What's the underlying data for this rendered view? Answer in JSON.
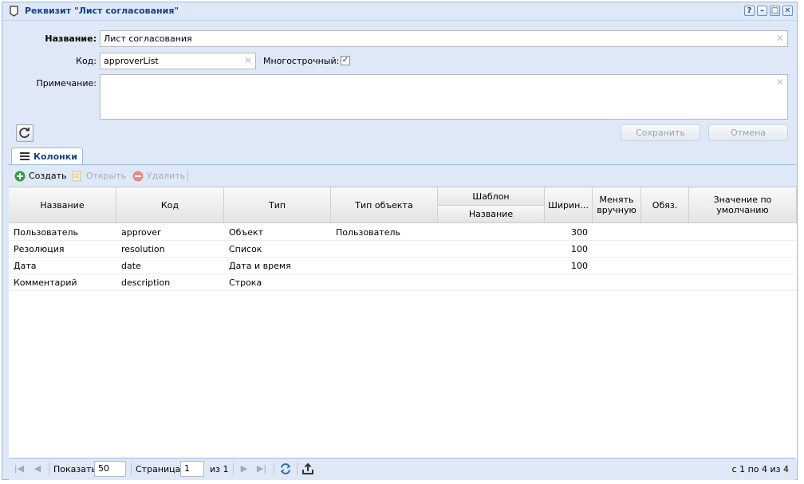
{
  "window": {
    "title": "Реквизит \"Лист согласования\"",
    "tools": [
      "?",
      "–",
      "□",
      "✕"
    ]
  },
  "form": {
    "name_label": "Название:",
    "name_value": "Лист согласования",
    "code_label": "Код:",
    "code_value": "approverList",
    "multiline_label": "Многострочный:",
    "multiline_checked": true,
    "note_label": "Примечание:",
    "note_value": "",
    "save_label": "Сохранить",
    "cancel_label": "Отмена"
  },
  "tabs": [
    {
      "label": "Колонки",
      "active": true
    }
  ],
  "grid_toolbar": {
    "create_label": "Создать",
    "open_label": "Открыть",
    "delete_label": "Удалить"
  },
  "grid": {
    "columns": {
      "name": "Название",
      "code": "Код",
      "type": "Тип",
      "object_type": "Тип объекта",
      "template": "Шаблон",
      "template_name": "Название",
      "width": "Ширин...",
      "editable": "Менять вручную",
      "required": "Обяз.",
      "default": "Значение по умолчанию"
    },
    "rows": [
      {
        "name": "Пользователь",
        "code": "approver",
        "type": "Объект",
        "object_type": "Пользователь",
        "template_name": "",
        "width": "300",
        "editable": "",
        "required": "",
        "default": ""
      },
      {
        "name": "Резолюция",
        "code": "resolution",
        "type": "Список",
        "object_type": "",
        "template_name": "",
        "width": "100",
        "editable": "",
        "required": "",
        "default": ""
      },
      {
        "name": "Дата",
        "code": "date",
        "type": "Дата и время",
        "object_type": "",
        "template_name": "",
        "width": "100",
        "editable": "",
        "required": "",
        "default": ""
      },
      {
        "name": "Комментарий",
        "code": "description",
        "type": "Строка",
        "object_type": "",
        "template_name": "",
        "width": "",
        "editable": "",
        "required": "",
        "default": ""
      }
    ]
  },
  "pager": {
    "show_label": "Показать",
    "page_size": "50",
    "page_label": "Страница",
    "page_value": "1",
    "of_label": "из 1",
    "summary": "с 1 по 4 из 4"
  },
  "colors": {
    "panel_bg": "#dfe8f6",
    "border": "#99bbe8",
    "title_text": "#15428b",
    "create_green": "#2e9e3e",
    "delete_red": "#e58a8a"
  }
}
